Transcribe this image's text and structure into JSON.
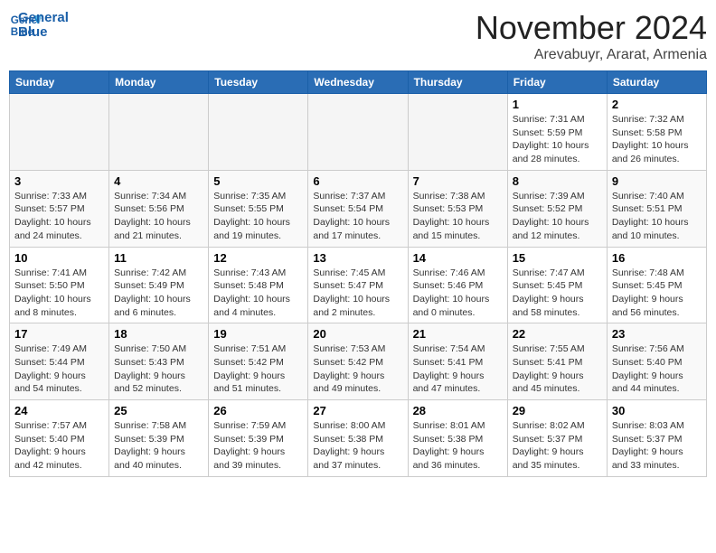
{
  "header": {
    "logo_line1": "General",
    "logo_line2": "Blue",
    "month": "November 2024",
    "location": "Arevabuyr, Ararat, Armenia"
  },
  "weekdays": [
    "Sunday",
    "Monday",
    "Tuesday",
    "Wednesday",
    "Thursday",
    "Friday",
    "Saturday"
  ],
  "weeks": [
    [
      {
        "day": "",
        "info": ""
      },
      {
        "day": "",
        "info": ""
      },
      {
        "day": "",
        "info": ""
      },
      {
        "day": "",
        "info": ""
      },
      {
        "day": "",
        "info": ""
      },
      {
        "day": "1",
        "info": "Sunrise: 7:31 AM\nSunset: 5:59 PM\nDaylight: 10 hours and 28 minutes."
      },
      {
        "day": "2",
        "info": "Sunrise: 7:32 AM\nSunset: 5:58 PM\nDaylight: 10 hours and 26 minutes."
      }
    ],
    [
      {
        "day": "3",
        "info": "Sunrise: 7:33 AM\nSunset: 5:57 PM\nDaylight: 10 hours and 24 minutes."
      },
      {
        "day": "4",
        "info": "Sunrise: 7:34 AM\nSunset: 5:56 PM\nDaylight: 10 hours and 21 minutes."
      },
      {
        "day": "5",
        "info": "Sunrise: 7:35 AM\nSunset: 5:55 PM\nDaylight: 10 hours and 19 minutes."
      },
      {
        "day": "6",
        "info": "Sunrise: 7:37 AM\nSunset: 5:54 PM\nDaylight: 10 hours and 17 minutes."
      },
      {
        "day": "7",
        "info": "Sunrise: 7:38 AM\nSunset: 5:53 PM\nDaylight: 10 hours and 15 minutes."
      },
      {
        "day": "8",
        "info": "Sunrise: 7:39 AM\nSunset: 5:52 PM\nDaylight: 10 hours and 12 minutes."
      },
      {
        "day": "9",
        "info": "Sunrise: 7:40 AM\nSunset: 5:51 PM\nDaylight: 10 hours and 10 minutes."
      }
    ],
    [
      {
        "day": "10",
        "info": "Sunrise: 7:41 AM\nSunset: 5:50 PM\nDaylight: 10 hours and 8 minutes."
      },
      {
        "day": "11",
        "info": "Sunrise: 7:42 AM\nSunset: 5:49 PM\nDaylight: 10 hours and 6 minutes."
      },
      {
        "day": "12",
        "info": "Sunrise: 7:43 AM\nSunset: 5:48 PM\nDaylight: 10 hours and 4 minutes."
      },
      {
        "day": "13",
        "info": "Sunrise: 7:45 AM\nSunset: 5:47 PM\nDaylight: 10 hours and 2 minutes."
      },
      {
        "day": "14",
        "info": "Sunrise: 7:46 AM\nSunset: 5:46 PM\nDaylight: 10 hours and 0 minutes."
      },
      {
        "day": "15",
        "info": "Sunrise: 7:47 AM\nSunset: 5:45 PM\nDaylight: 9 hours and 58 minutes."
      },
      {
        "day": "16",
        "info": "Sunrise: 7:48 AM\nSunset: 5:45 PM\nDaylight: 9 hours and 56 minutes."
      }
    ],
    [
      {
        "day": "17",
        "info": "Sunrise: 7:49 AM\nSunset: 5:44 PM\nDaylight: 9 hours and 54 minutes."
      },
      {
        "day": "18",
        "info": "Sunrise: 7:50 AM\nSunset: 5:43 PM\nDaylight: 9 hours and 52 minutes."
      },
      {
        "day": "19",
        "info": "Sunrise: 7:51 AM\nSunset: 5:42 PM\nDaylight: 9 hours and 51 minutes."
      },
      {
        "day": "20",
        "info": "Sunrise: 7:53 AM\nSunset: 5:42 PM\nDaylight: 9 hours and 49 minutes."
      },
      {
        "day": "21",
        "info": "Sunrise: 7:54 AM\nSunset: 5:41 PM\nDaylight: 9 hours and 47 minutes."
      },
      {
        "day": "22",
        "info": "Sunrise: 7:55 AM\nSunset: 5:41 PM\nDaylight: 9 hours and 45 minutes."
      },
      {
        "day": "23",
        "info": "Sunrise: 7:56 AM\nSunset: 5:40 PM\nDaylight: 9 hours and 44 minutes."
      }
    ],
    [
      {
        "day": "24",
        "info": "Sunrise: 7:57 AM\nSunset: 5:40 PM\nDaylight: 9 hours and 42 minutes."
      },
      {
        "day": "25",
        "info": "Sunrise: 7:58 AM\nSunset: 5:39 PM\nDaylight: 9 hours and 40 minutes."
      },
      {
        "day": "26",
        "info": "Sunrise: 7:59 AM\nSunset: 5:39 PM\nDaylight: 9 hours and 39 minutes."
      },
      {
        "day": "27",
        "info": "Sunrise: 8:00 AM\nSunset: 5:38 PM\nDaylight: 9 hours and 37 minutes."
      },
      {
        "day": "28",
        "info": "Sunrise: 8:01 AM\nSunset: 5:38 PM\nDaylight: 9 hours and 36 minutes."
      },
      {
        "day": "29",
        "info": "Sunrise: 8:02 AM\nSunset: 5:37 PM\nDaylight: 9 hours and 35 minutes."
      },
      {
        "day": "30",
        "info": "Sunrise: 8:03 AM\nSunset: 5:37 PM\nDaylight: 9 hours and 33 minutes."
      }
    ]
  ]
}
